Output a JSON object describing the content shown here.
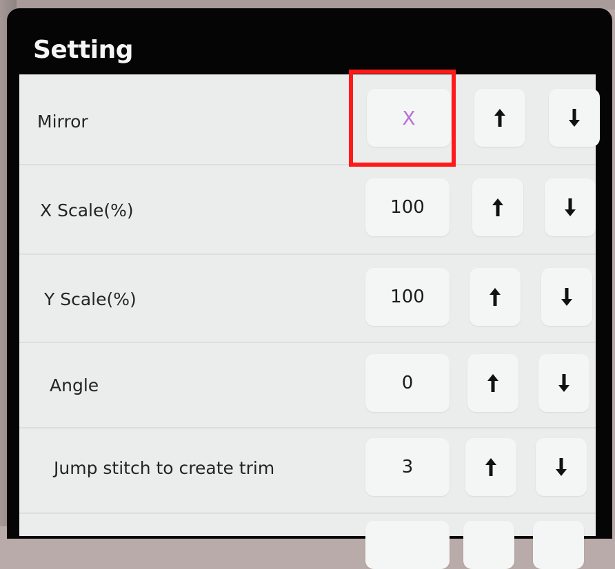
{
  "dialog": {
    "title": "Setting"
  },
  "settings": [
    {
      "label": "Mirror",
      "value": "X",
      "up_icon": "arrow-up-icon",
      "down_icon": "arrow-down-icon"
    },
    {
      "label": "X Scale(%)",
      "value": "100",
      "up_icon": "arrow-up-icon",
      "down_icon": "arrow-down-icon"
    },
    {
      "label": "Y Scale(%)",
      "value": "100",
      "up_icon": "arrow-up-icon",
      "down_icon": "arrow-down-icon"
    },
    {
      "label": "Angle",
      "value": "0",
      "up_icon": "arrow-up-icon",
      "down_icon": "arrow-down-icon"
    },
    {
      "label": "Jump stitch to create trim",
      "value": "3",
      "up_icon": "arrow-up-icon",
      "down_icon": "arrow-down-icon"
    }
  ],
  "colors": {
    "highlight": "#ff1a1a",
    "mirror_value": "#b871d9",
    "panel": "#ebecec",
    "button": "#f4f5f5",
    "title_bar": "#050505"
  }
}
